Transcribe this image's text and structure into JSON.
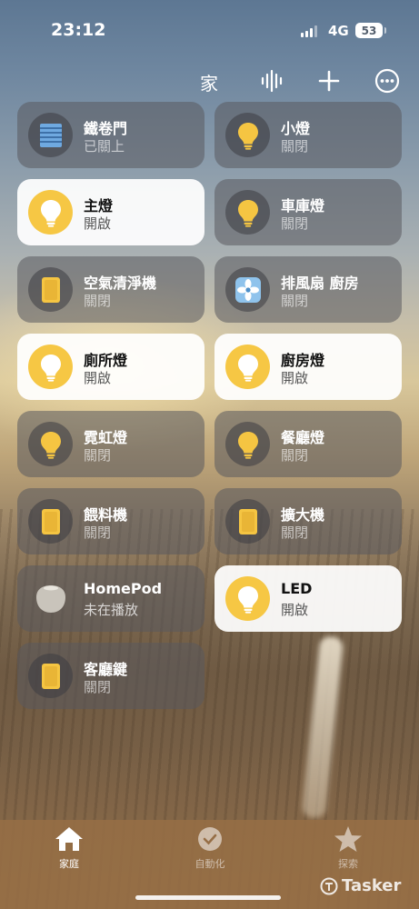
{
  "status_bar": {
    "time": "23:12",
    "network": "4G",
    "battery": "53"
  },
  "toolbar": {
    "title": "家"
  },
  "tiles": [
    {
      "name": "鐵卷門",
      "state": "已關上",
      "on": false,
      "icon": "shutter-icon"
    },
    {
      "name": "小燈",
      "state": "關閉",
      "on": false,
      "icon": "lightbulb-icon"
    },
    {
      "name": "主燈",
      "state": "開啟",
      "on": true,
      "icon": "lightbulb-icon"
    },
    {
      "name": "車庫燈",
      "state": "關閉",
      "on": false,
      "icon": "lightbulb-icon"
    },
    {
      "name": "空氣清淨機",
      "state": "關閉",
      "on": false,
      "icon": "outlet-icon"
    },
    {
      "name": "排風扇 廚房",
      "state": "關閉",
      "on": false,
      "icon": "fan-icon"
    },
    {
      "name": "廁所燈",
      "state": "開啟",
      "on": true,
      "icon": "lightbulb-icon"
    },
    {
      "name": "廚房燈",
      "state": "開啟",
      "on": true,
      "icon": "lightbulb-icon"
    },
    {
      "name": "霓虹燈",
      "state": "關閉",
      "on": false,
      "icon": "lightbulb-icon"
    },
    {
      "name": "餐廳燈",
      "state": "關閉",
      "on": false,
      "icon": "lightbulb-icon"
    },
    {
      "name": "餵料機",
      "state": "關閉",
      "on": false,
      "icon": "outlet-icon"
    },
    {
      "name": "擴大機",
      "state": "關閉",
      "on": false,
      "icon": "outlet-icon"
    },
    {
      "name": "HomePod",
      "state": "未在播放",
      "on": false,
      "icon": "homepod-icon"
    },
    {
      "name": "LED",
      "state": "開啟",
      "on": true,
      "icon": "lightbulb-icon"
    },
    {
      "name": "客廳鍵",
      "state": "關閉",
      "on": false,
      "icon": "outlet-icon"
    }
  ],
  "tabbar": {
    "home": "家庭",
    "automation": "自動化",
    "explore": "探索"
  },
  "watermark": "Tasker",
  "colors": {
    "accent_on": "#f6c744",
    "tile_on_bg": "#ffffff",
    "tile_off_bg": "#5a5a5f"
  }
}
